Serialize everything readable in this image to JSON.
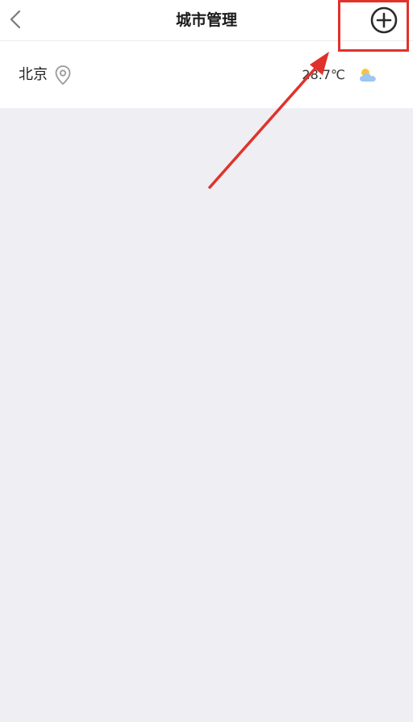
{
  "header": {
    "title": "城市管理",
    "back_icon": "chevron-left-icon",
    "add_icon": "plus-circle-icon"
  },
  "cities": [
    {
      "name": "北京",
      "location_icon": "location-pin-icon",
      "temperature": "28.7℃",
      "weather_icon": "partly-cloudy-icon"
    }
  ],
  "colors": {
    "annotation": "#e0322b",
    "background": "#efeef3",
    "weather_sun": "#f5c542",
    "weather_cloud": "#9ec6f0"
  }
}
